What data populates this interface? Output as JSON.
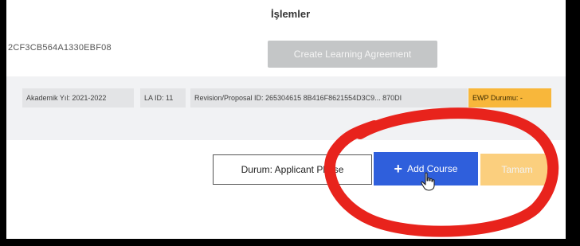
{
  "header": {
    "title": "İşlemler"
  },
  "agreement": {
    "id_fragment": "2CF3CB564A1330EBF08",
    "create_button": "Create Learning Agreement"
  },
  "info_tags": {
    "academic_year": "Akademik Yıl: 2021-2022",
    "la_id": "LA ID: 11",
    "revision": "Revision/Proposal ID: 265304615 8B416F8621554D3C9... 870DI",
    "ewp_status": "EWP Durumu: -"
  },
  "actions": {
    "status_button": "Durum: Applicant Phase",
    "add_course_button": "Add Course",
    "tamam_button": "Tamam"
  },
  "colors": {
    "primary": "#2f5fdc",
    "warning": "#f8b73b",
    "annotation": "#e8231c"
  },
  "icons": {
    "add": "plus-icon",
    "pointer": "hand-cursor-icon"
  }
}
